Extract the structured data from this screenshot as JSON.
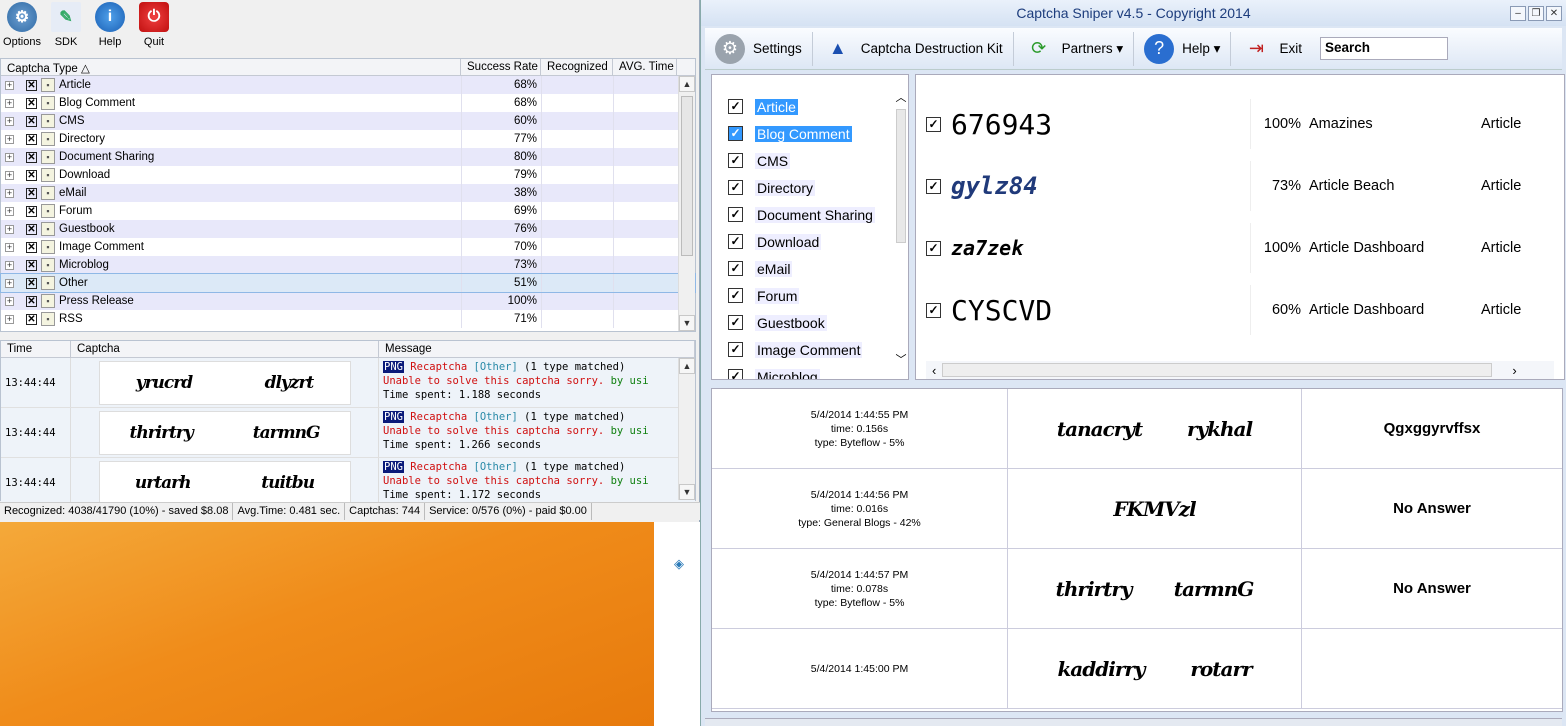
{
  "left_app": {
    "toolbar": [
      {
        "label": "Options",
        "icon": "gear-icon"
      },
      {
        "label": "SDK",
        "icon": "sdk-icon"
      },
      {
        "label": "Help",
        "icon": "info-icon"
      },
      {
        "label": "Quit",
        "icon": "power-icon"
      }
    ],
    "grid_headers": [
      "Captcha Type",
      "Success Rate",
      "Recognized",
      "AVG. Time"
    ],
    "sort_glyph": "△",
    "rows": [
      {
        "type": "Article",
        "rate": "68%"
      },
      {
        "type": "Blog Comment",
        "rate": "68%"
      },
      {
        "type": "CMS",
        "rate": "60%"
      },
      {
        "type": "Directory",
        "rate": "77%"
      },
      {
        "type": "Document Sharing",
        "rate": "80%"
      },
      {
        "type": "Download",
        "rate": "79%"
      },
      {
        "type": "eMail",
        "rate": "38%"
      },
      {
        "type": "Forum",
        "rate": "69%"
      },
      {
        "type": "Guestbook",
        "rate": "76%"
      },
      {
        "type": "Image Comment",
        "rate": "70%"
      },
      {
        "type": "Microblog",
        "rate": "73%"
      },
      {
        "type": "Other",
        "rate": "51%"
      },
      {
        "type": "Press Release",
        "rate": "100%"
      },
      {
        "type": "RSS",
        "rate": "71%"
      }
    ],
    "log_headers": [
      "Time",
      "Captcha",
      "Message"
    ],
    "log": [
      {
        "time": "13:44:44",
        "captcha": [
          "yrucrd",
          "dlyzrt"
        ],
        "line1_tag": "PNG",
        "line1_type": "Recaptcha",
        "line1_cat": "[Other]",
        "line1_rest": "(1 type matched)",
        "line2": "Unable to solve this captcha sorry.",
        "line2b": "by usi",
        "line3": "Time spent:  1.188 seconds"
      },
      {
        "time": "13:44:44",
        "captcha": [
          "thrirtry",
          "tarmnG"
        ],
        "line1_tag": "PNG",
        "line1_type": "Recaptcha",
        "line1_cat": "[Other]",
        "line1_rest": "(1 type matched)",
        "line2": "Unable to solve this captcha sorry.",
        "line2b": "by usi",
        "line3": "Time spent:  1.266 seconds"
      },
      {
        "time": "13:44:44",
        "captcha": [
          "urtarh",
          "tuitbu"
        ],
        "line1_tag": "PNG",
        "line1_type": "Recaptcha",
        "line1_cat": "[Other]",
        "line1_rest": "(1 type matched)",
        "line2": "Unable to solve this captcha sorry.",
        "line2b": "by usi",
        "line3": "Time spent:  1.172 seconds"
      }
    ],
    "status": [
      "Recognized: 4038/41790 (10%) - saved $8.08",
      "Avg.Time: 0.481 sec.",
      "Captchas: 744",
      "Service: 0/576 (0%) - paid $0.00"
    ]
  },
  "right_app": {
    "title": "Captcha Sniper v4.5 - Copyright 2014",
    "toolbar": [
      {
        "label": "Settings",
        "icon": "gear-icon"
      },
      {
        "label": "Captcha Destruction Kit",
        "icon": "wizard-icon"
      },
      {
        "label": "Partners ▾",
        "icon": "refresh-icon"
      },
      {
        "label": "Help ▾",
        "icon": "help-icon"
      },
      {
        "label": "Exit",
        "icon": "exit-icon"
      }
    ],
    "search_value": "Search",
    "categories": [
      "Article",
      "Blog Comment",
      "CMS",
      "Directory",
      "Document Sharing",
      "Download",
      "eMail",
      "Forum",
      "Guestbook",
      "Image Comment",
      "Microblog"
    ],
    "results": [
      {
        "captcha": "676943",
        "rate": "100%",
        "site": "Amazines",
        "cat": "Article"
      },
      {
        "captcha": "gylz84",
        "rate": "73%",
        "site": "Article Beach",
        "cat": "Article"
      },
      {
        "captcha": "za7zek",
        "rate": "100%",
        "site": "Article Dashboard",
        "cat": "Article"
      },
      {
        "captcha": "CYSCVD",
        "rate": "60%",
        "site": "Article Dashboard",
        "cat": "Article"
      }
    ],
    "history": [
      {
        "date": "5/4/2014 1:44:55 PM",
        "time": "time: 0.156s",
        "type": "type: Byteflow - 5%",
        "img": [
          "tanacryt",
          "rykhal"
        ],
        "answer": "Qgxggyrvffsx"
      },
      {
        "date": "5/4/2014 1:44:56 PM",
        "time": "time: 0.016s",
        "type": "type: General Blogs - 42%",
        "img": [
          "FKMVzl"
        ],
        "answer": "No Answer"
      },
      {
        "date": "5/4/2014 1:44:57 PM",
        "time": "time: 0.078s",
        "type": "type: Byteflow - 5%",
        "img": [
          "thrirtry",
          "tarmnG"
        ],
        "answer": "No Answer"
      },
      {
        "date": "5/4/2014 1:45:00 PM",
        "time": "",
        "type": "",
        "img": [
          "kaddirry",
          "rotarr"
        ],
        "answer": ""
      }
    ]
  }
}
